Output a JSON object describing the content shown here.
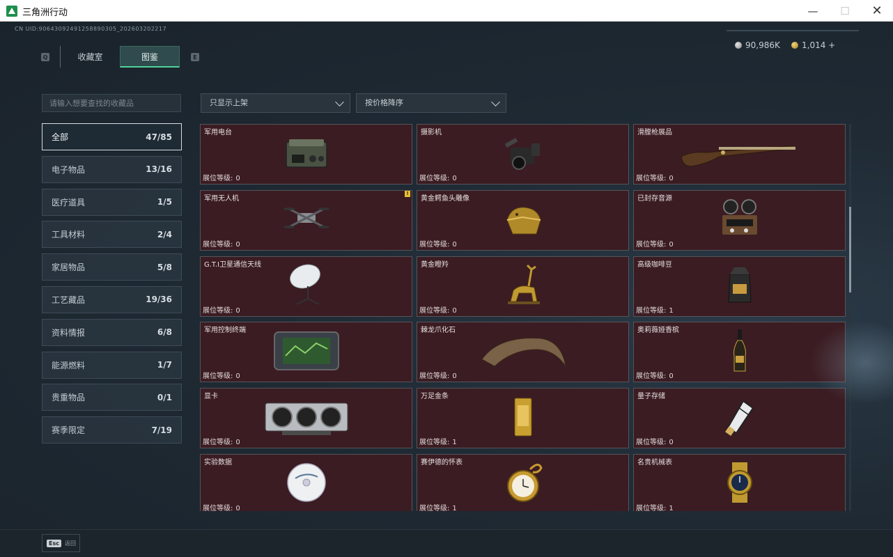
{
  "window": {
    "title": "三角洲行动"
  },
  "header": {
    "uid": "CN UID:90643092491258890305_202603202217",
    "currency": {
      "silver": "90,986K",
      "gold": "1,014 +"
    },
    "tab_key_left": "Q",
    "tab_key_right": "E",
    "tabs": [
      {
        "label": "收藏室"
      },
      {
        "label": "图鉴"
      }
    ]
  },
  "search": {
    "placeholder": "请输入想要查找的收藏品"
  },
  "categories": [
    {
      "label": "全部",
      "count": "47/85"
    },
    {
      "label": "电子物品",
      "count": "13/16"
    },
    {
      "label": "医疗道具",
      "count": "1/5"
    },
    {
      "label": "工具材料",
      "count": "2/4"
    },
    {
      "label": "家居物品",
      "count": "5/8"
    },
    {
      "label": "工艺藏品",
      "count": "19/36"
    },
    {
      "label": "资料情报",
      "count": "6/8"
    },
    {
      "label": "能源燃料",
      "count": "1/7"
    },
    {
      "label": "贵重物品",
      "count": "0/1"
    },
    {
      "label": "赛季限定",
      "count": "7/19"
    }
  ],
  "filters": {
    "show": "只显示上架",
    "sort": "按价格降序"
  },
  "level_label": "展位等级:",
  "items": [
    {
      "name": "军用电台",
      "level": "0"
    },
    {
      "name": "摄影机",
      "level": "0"
    },
    {
      "name": "滑膛枪展品",
      "level": "0"
    },
    {
      "name": "军用无人机",
      "level": "0",
      "badge": "!"
    },
    {
      "name": "黄金鳄鱼头雕像",
      "level": "0"
    },
    {
      "name": "已封存音源",
      "level": "0"
    },
    {
      "name": "G.T.I卫星通信天线",
      "level": "0"
    },
    {
      "name": "黄金瞪羚",
      "level": "0"
    },
    {
      "name": "高级咖啡豆",
      "level": "1"
    },
    {
      "name": "军用控制终端",
      "level": "0"
    },
    {
      "name": "棘龙爪化石",
      "level": "0"
    },
    {
      "name": "奥莉薇娅香槟",
      "level": "0"
    },
    {
      "name": "显卡",
      "level": "0"
    },
    {
      "name": "万足金条",
      "level": "1"
    },
    {
      "name": "量子存储",
      "level": "0"
    },
    {
      "name": "实验数据",
      "level": "0"
    },
    {
      "name": "赛伊德的怀表",
      "level": "1"
    },
    {
      "name": "名贵机械表",
      "level": "1"
    }
  ],
  "footer": {
    "esc_key": "Esc",
    "back_label": "返回"
  }
}
